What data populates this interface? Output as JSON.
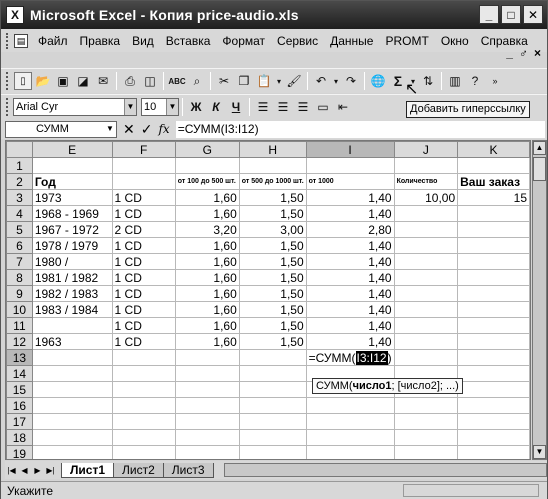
{
  "window": {
    "title": "Microsoft Excel - Копия price-audio.xls",
    "app_icon": "X",
    "buttons": [
      "_",
      "□",
      "✕"
    ]
  },
  "menu": [
    "Файл",
    "Правка",
    "Вид",
    "Вставка",
    "Формат",
    "Сервис",
    "Данные",
    "PROMT",
    "Окно",
    "Справка"
  ],
  "mdi": [
    "_",
    "♂",
    "×"
  ],
  "format_bar": {
    "font": "Arial Cyr",
    "size": "10",
    "bold": "Ж",
    "italic": "К",
    "underline": "Ч"
  },
  "tooltip": "Добавить гиперссылку",
  "formula_bar": {
    "name_box": "СУММ",
    "formula": "=СУММ(I3:I12)",
    "fx": "fx"
  },
  "columns": [
    "E",
    "F",
    "G",
    "H",
    "I",
    "J",
    "K"
  ],
  "rows": [
    {
      "n": "1",
      "E": "",
      "F": "",
      "G": "",
      "H": "",
      "I": "",
      "J": "",
      "K": ""
    },
    {
      "n": "2",
      "E": "Год",
      "F": "",
      "G": "от 100 до 500 шт.",
      "H": "от 500 до 1000 шт.",
      "I": "от 1000",
      "J": "Количество",
      "K": "Ваш заказ"
    },
    {
      "n": "3",
      "E": "1973",
      "F": "1 CD",
      "G": "1,60",
      "H": "1,50",
      "I": "1,40",
      "J": "10,00",
      "K": "15"
    },
    {
      "n": "4",
      "E": "1968 - 1969",
      "F": "1 CD",
      "G": "1,60",
      "H": "1,50",
      "I": "1,40",
      "J": "",
      "K": ""
    },
    {
      "n": "5",
      "E": "1967 - 1972",
      "F": "2 CD",
      "G": "3,20",
      "H": "3,00",
      "I": "2,80",
      "J": "",
      "K": ""
    },
    {
      "n": "6",
      "E": "1978 / 1979",
      "F": "1 CD",
      "G": "1,60",
      "H": "1,50",
      "I": "1,40",
      "J": "",
      "K": ""
    },
    {
      "n": "7",
      "E": "1980 /",
      "F": "1 CD",
      "G": "1,60",
      "H": "1,50",
      "I": "1,40",
      "J": "",
      "K": ""
    },
    {
      "n": "8",
      "E": "1981 / 1982",
      "F": "1 CD",
      "G": "1,60",
      "H": "1,50",
      "I": "1,40",
      "J": "",
      "K": ""
    },
    {
      "n": "9",
      "E": "1982 / 1983",
      "F": "1 CD",
      "G": "1,60",
      "H": "1,50",
      "I": "1,40",
      "J": "",
      "K": ""
    },
    {
      "n": "10",
      "E": "1983 / 1984",
      "F": "1 CD",
      "G": "1,60",
      "H": "1,50",
      "I": "1,40",
      "J": "",
      "K": ""
    },
    {
      "n": "11",
      "E": "",
      "F": "1 CD",
      "G": "1,60",
      "H": "1,50",
      "I": "1,40",
      "J": "",
      "K": ""
    },
    {
      "n": "12",
      "E": "1963",
      "F": "1 CD",
      "G": "1,60",
      "H": "1,50",
      "I": "1,40",
      "J": "",
      "K": ""
    },
    {
      "n": "13",
      "E": "",
      "F": "",
      "G": "",
      "H": "",
      "I": "",
      "J": "",
      "K": ""
    },
    {
      "n": "14",
      "E": "",
      "F": "",
      "G": "",
      "H": "",
      "I": "",
      "J": "",
      "K": ""
    },
    {
      "n": "15",
      "E": "",
      "F": "",
      "G": "",
      "H": "",
      "I": "",
      "J": "",
      "K": ""
    },
    {
      "n": "16",
      "E": "",
      "F": "",
      "G": "",
      "H": "",
      "I": "",
      "J": "",
      "K": ""
    },
    {
      "n": "17",
      "E": "",
      "F": "",
      "G": "",
      "H": "",
      "I": "",
      "J": "",
      "K": ""
    },
    {
      "n": "18",
      "E": "",
      "F": "",
      "G": "",
      "H": "",
      "I": "",
      "J": "",
      "K": ""
    },
    {
      "n": "19",
      "E": "",
      "F": "",
      "G": "",
      "H": "",
      "I": "",
      "J": "",
      "K": ""
    }
  ],
  "edit_cell": {
    "prefix": "=СУММ(",
    "ref": "I3:I12",
    "suffix": ")"
  },
  "arg_tip": {
    "fn": "СУММ(",
    "arg1": "число1",
    "rest": "; [число2]; ...)"
  },
  "sheets": [
    "Лист1",
    "Лист2",
    "Лист3"
  ],
  "active_sheet": "Лист1",
  "status": "Укажите"
}
